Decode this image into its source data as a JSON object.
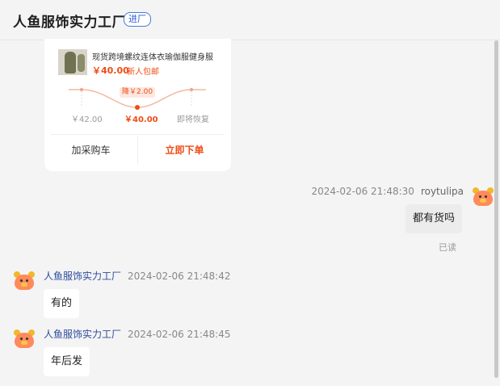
{
  "header": {
    "shop_name": "人鱼服饰实力工厂",
    "enter_badge": "进厂"
  },
  "product_card": {
    "title": "现货跨境螺纹连体衣瑜伽服健身服",
    "price": "￥40.00",
    "tag": "新人包邮",
    "drop_badge": "降￥2.00",
    "price_points": [
      {
        "label": "￥42.00"
      },
      {
        "label": "￥40.00"
      },
      {
        "label": "即将恢复"
      }
    ],
    "add_cart_label": "加采购车",
    "buy_now_label": "立即下单"
  },
  "messages": [
    {
      "side": "right",
      "sender": "roytulipa",
      "time": "2024-02-06 21:48:30",
      "text": "都有货吗",
      "status": "已读"
    },
    {
      "side": "left",
      "sender": "人鱼服饰实力工厂",
      "time": "2024-02-06 21:48:42",
      "text": "有的"
    },
    {
      "side": "left",
      "sender": "人鱼服饰实力工厂",
      "time": "2024-02-06 21:48:45",
      "text": "年后发"
    }
  ],
  "colors": {
    "accent": "#f04b14",
    "sender_name": "#2d4c9c",
    "badge": "#2a5bd7"
  }
}
